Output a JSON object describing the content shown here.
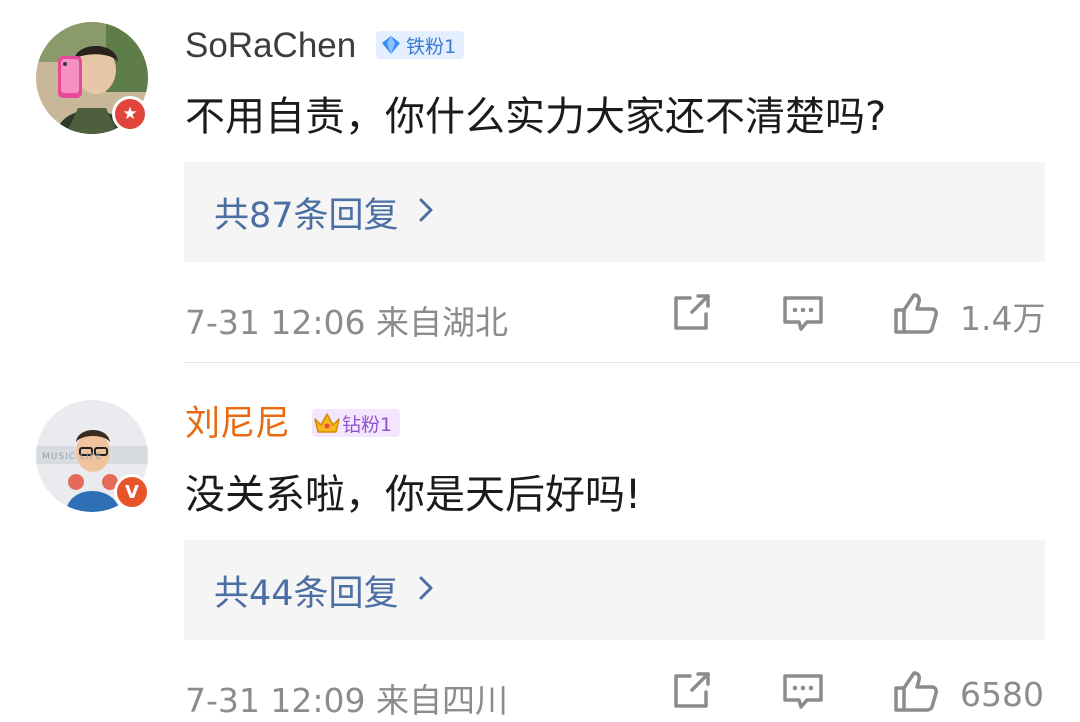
{
  "comments": [
    {
      "username": "SoRaChen",
      "fan_badge": "铁粉1",
      "badge_icon": "diamond-icon",
      "avatar_badge_icon": "star-icon",
      "content": "不用自责，你什么实力大家还不清楚吗?",
      "replies_label": "共87条回复",
      "timestamp": "7-31 12:06",
      "location": "来自湖北",
      "likes": "1.4万",
      "colors": {
        "username": "#3d3d3d",
        "badge_bg": "#e3efff",
        "badge_fg": "#3b79d6"
      }
    },
    {
      "username": "刘尼尼",
      "fan_badge": "钻粉1",
      "badge_icon": "crown-icon",
      "avatar_badge": "V",
      "avatar_badge_icon": "verified-v-icon",
      "avatar_text": "MUSIC LIFE",
      "content": "没关系啦，你是天后好吗!",
      "replies_label": "共44条回复",
      "timestamp": "7-31 12:09",
      "location": "来自四川",
      "likes": "6580",
      "colors": {
        "username": "#e86b12",
        "badge_bg": "#f4e6ff",
        "badge_fg": "#8f55cc"
      }
    }
  ],
  "colors": {
    "link": "#4c6fa3",
    "meta": "#8c8c8c",
    "reply_bg": "#f5f5f5"
  }
}
